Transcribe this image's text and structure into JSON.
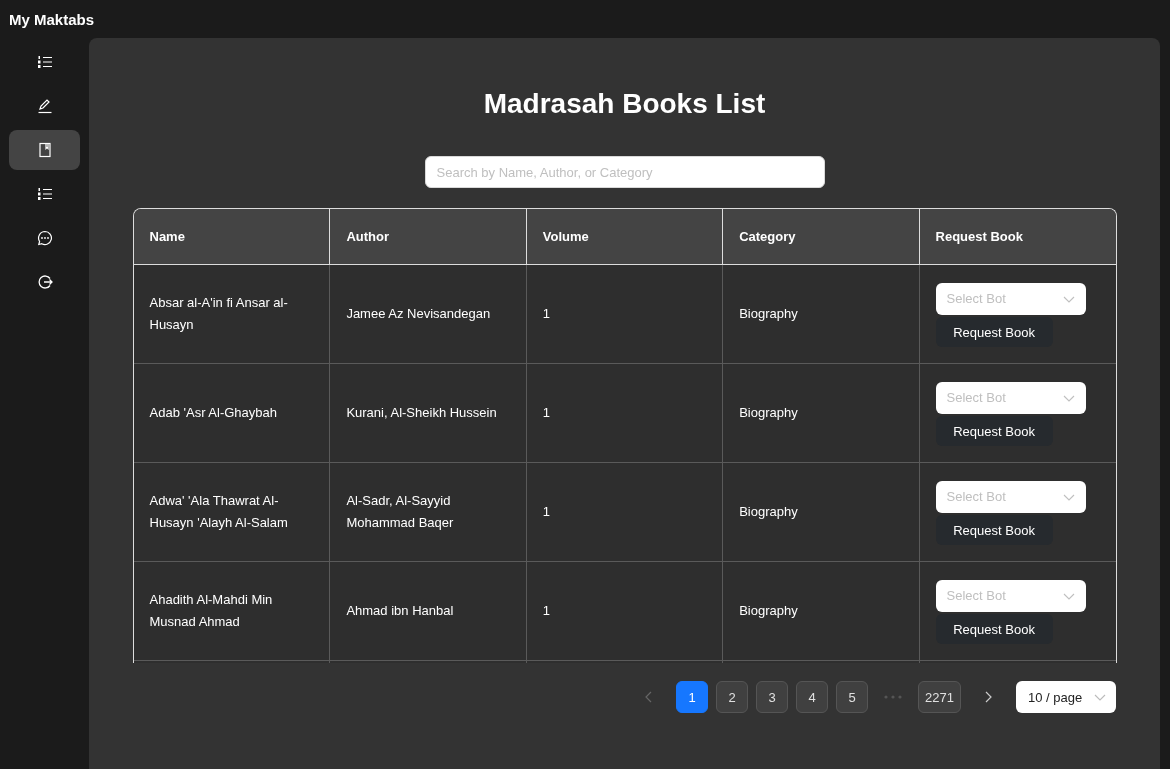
{
  "app": {
    "title": "My Maktabs"
  },
  "sidebar": {
    "items": [
      {
        "selected": false
      },
      {
        "selected": false
      },
      {
        "selected": true
      },
      {
        "selected": false
      },
      {
        "selected": false
      },
      {
        "selected": false
      }
    ]
  },
  "page": {
    "title": "Madrasah Books List"
  },
  "search": {
    "placeholder": "Search by Name, Author, or Category"
  },
  "table": {
    "columns": [
      "Name",
      "Author",
      "Volume",
      "Category",
      "Request Book"
    ],
    "rows": [
      {
        "name": "Absar al-A'in fi Ansar al-Husayn",
        "author": "Jamee Az Nevisandegan",
        "volume": "1",
        "category": "Biography",
        "select_placeholder": "Select Bot",
        "button": "Request Book"
      },
      {
        "name": "Adab 'Asr Al-Ghaybah",
        "author": "Kurani, Al-Sheikh Hussein",
        "volume": "1",
        "category": "Biography",
        "select_placeholder": "Select Bot",
        "button": "Request Book"
      },
      {
        "name": "Adwa' 'Ala Thawrat Al-Husayn 'Alayh Al-Salam",
        "author": "Al-Sadr, Al-Sayyid Mohammad Baqer",
        "volume": "1",
        "category": "Biography",
        "select_placeholder": "Select Bot",
        "button": "Request Book"
      },
      {
        "name": "Ahadith Al-Mahdi Min Musnad Ahmad",
        "author": "Ahmad ibn Hanbal",
        "volume": "1",
        "category": "Biography",
        "select_placeholder": "Select Bot",
        "button": "Request Book"
      }
    ]
  },
  "pagination": {
    "pages": [
      {
        "label": "1",
        "selected": true
      },
      {
        "label": "2",
        "selected": false
      },
      {
        "label": "3",
        "selected": false
      },
      {
        "label": "4",
        "selected": false
      },
      {
        "label": "5",
        "selected": false
      },
      {
        "label": "2271",
        "selected": false,
        "kind": "last"
      }
    ],
    "page_size": "10 / page"
  }
}
